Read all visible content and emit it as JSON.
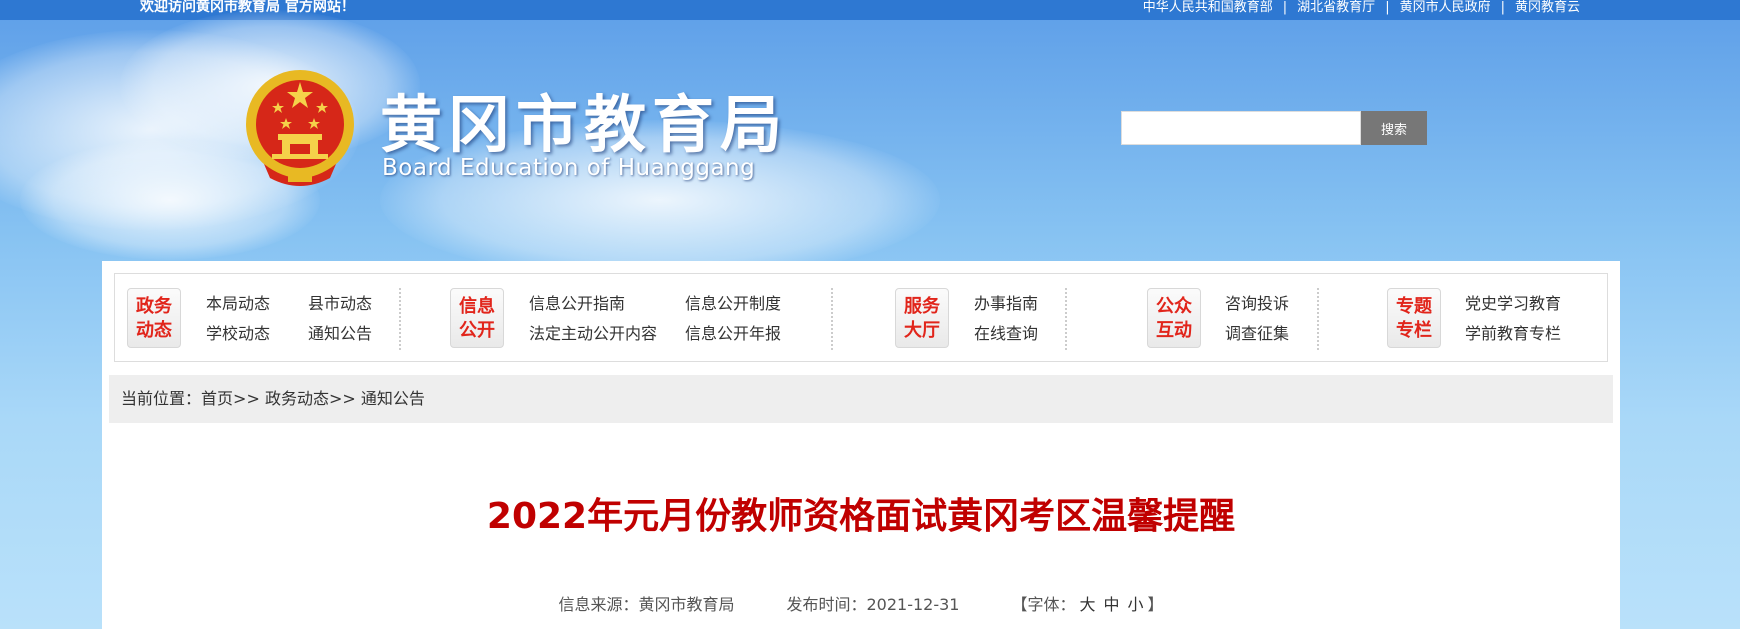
{
  "topbar": {
    "welcome": "欢迎访问黄冈市教育局 官方网站！",
    "links": [
      "中华人民共和国教育部",
      "湖北省教育厅",
      "黄冈市人民政府",
      "黄冈教育云"
    ],
    "separator": "|"
  },
  "header": {
    "title": "黄冈市教育局",
    "subtitle": "Board Education of Huanggang",
    "emblem_icon": "national-emblem-icon"
  },
  "search": {
    "placeholder": "",
    "button_label": "搜索"
  },
  "nav": {
    "groups": [
      {
        "badge": [
          "政务",
          "动态"
        ],
        "links": [
          "本局动态",
          "县市动态",
          "学校动态",
          "通知公告"
        ]
      },
      {
        "badge": [
          "信息",
          "公开"
        ],
        "links": [
          "信息公开指南",
          "信息公开制度",
          "法定主动公开内容",
          "信息公开年报"
        ]
      },
      {
        "badge": [
          "服务",
          "大厅"
        ],
        "links": [
          "办事指南",
          "在线查询"
        ]
      },
      {
        "badge": [
          "公众",
          "互动"
        ],
        "links": [
          "咨询投诉",
          "调查征集"
        ]
      },
      {
        "badge": [
          "专题",
          "专栏"
        ],
        "links": [
          "党史学习教育",
          "学前教育专栏"
        ]
      }
    ]
  },
  "breadcrumb": {
    "prefix": "当前位置：",
    "items": [
      "首页",
      "政务动态",
      "通知公告"
    ],
    "separator": ">>"
  },
  "article": {
    "title": "2022年元月份教师资格面试黄冈考区温馨提醒",
    "source_label": "信息来源：",
    "source": "黄冈市教育局",
    "date_label": "发布时间：",
    "date": "2021-12-31",
    "font_prefix": "【字体：",
    "font_sizes": [
      "大",
      "中",
      "小"
    ],
    "font_suffix": "】"
  },
  "colors": {
    "topbar": "#2e78d2",
    "accent_red": "#c00000",
    "badge_red": "#e1251b",
    "search_button": "#777777"
  }
}
